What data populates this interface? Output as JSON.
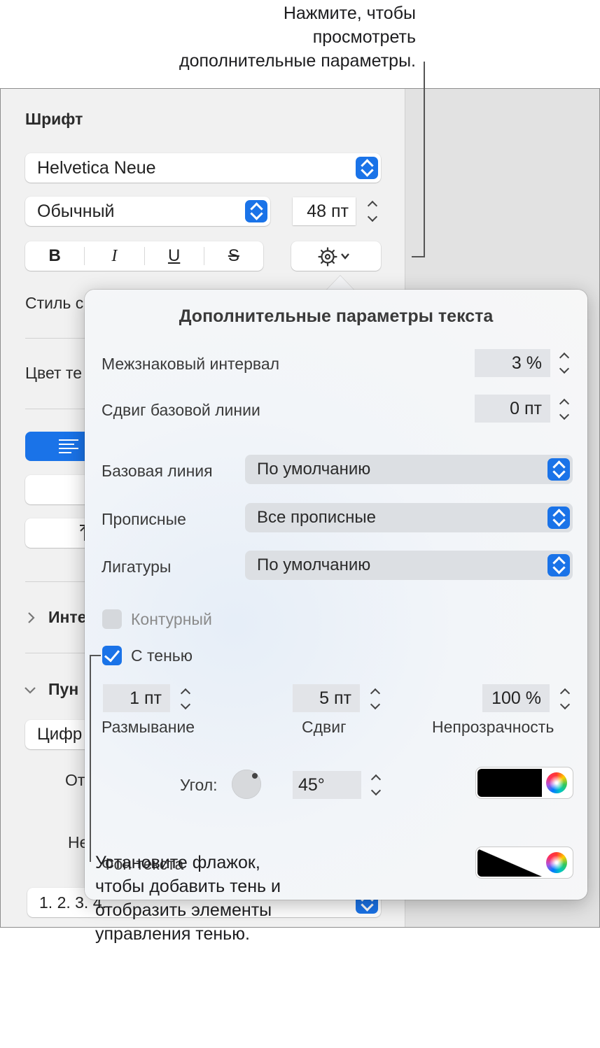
{
  "callouts": {
    "top_line1": "Нажмите, чтобы",
    "top_line2": "просмотреть",
    "top_line3": "дополнительные параметры.",
    "bottom_line1": "Установите флажок,",
    "bottom_line2": "чтобы добавить тень и",
    "bottom_line3": "отобразить элементы",
    "bottom_line4": "управления тенью."
  },
  "sidebar": {
    "font_title": "Шрифт",
    "font_family": "Helvetica Neue",
    "font_style": "Обычный",
    "font_size": "48 пт",
    "bold": "B",
    "italic": "I",
    "underline": "U",
    "strike": "S",
    "style_label": "Стиль с",
    "color_label": "Цвет те",
    "section_inte": "Инте",
    "section_pun": "Пун",
    "list_popup": "Цифр",
    "label_ot": "От",
    "label_ne": "Не",
    "list_format": "1. 2. 3. 4."
  },
  "popover": {
    "title": "Дополнительные параметры текста",
    "char_spacing_label": "Межзнаковый интервал",
    "char_spacing_value": "3 %",
    "baseline_shift_label": "Сдвиг базовой линии",
    "baseline_shift_value": "0 пт",
    "baseline_label": "Базовая линия",
    "baseline_value": "По умолчанию",
    "caps_label": "Прописные",
    "caps_value": "Все прописные",
    "ligatures_label": "Лигатуры",
    "ligatures_value": "По умолчанию",
    "outline_label": "Контурный",
    "outline_checked": false,
    "shadow_label": "С тенью",
    "shadow_checked": true,
    "blur_value": "1 пт",
    "blur_label": "Размывание",
    "offset_value": "5 пт",
    "offset_label": "Сдвиг",
    "opacity_value": "100 %",
    "opacity_label": "Непрозрачность",
    "angle_label": "Угол:",
    "angle_value": "45°",
    "shadow_color": "#000000",
    "text_bg_label": "Фон текста"
  },
  "colors": {
    "accent": "#1a73e8"
  }
}
